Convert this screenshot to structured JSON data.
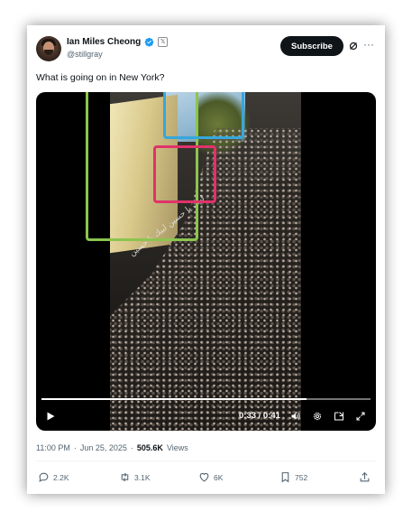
{
  "author": {
    "display_name": "Ian Miles Cheong",
    "handle": "@stillgray",
    "affiliation_badge": "𝕏"
  },
  "header": {
    "subscribe_label": "Subscribe",
    "more_label": "···"
  },
  "tweet": {
    "text": "What is going on in New York?"
  },
  "video": {
    "time_label": "0:33 / 0:41",
    "progress": 0.805,
    "banner_text": "لبيك يا حسين لبيك يا حسين",
    "annotation_colors": [
      "#8bc44f",
      "#35a7dd",
      "#e0326b"
    ]
  },
  "meta": {
    "time": "11:00 PM",
    "separator": "·",
    "date": "Jun 25, 2025",
    "views_count": "505.6K",
    "views_label": "Views"
  },
  "actions": {
    "replies": "2.2K",
    "reposts": "3.1K",
    "likes": "6K",
    "bookmarks": "752"
  },
  "colors": {
    "verified": "#1d9bf0",
    "text_primary": "#0f1419",
    "text_secondary": "#536471"
  }
}
